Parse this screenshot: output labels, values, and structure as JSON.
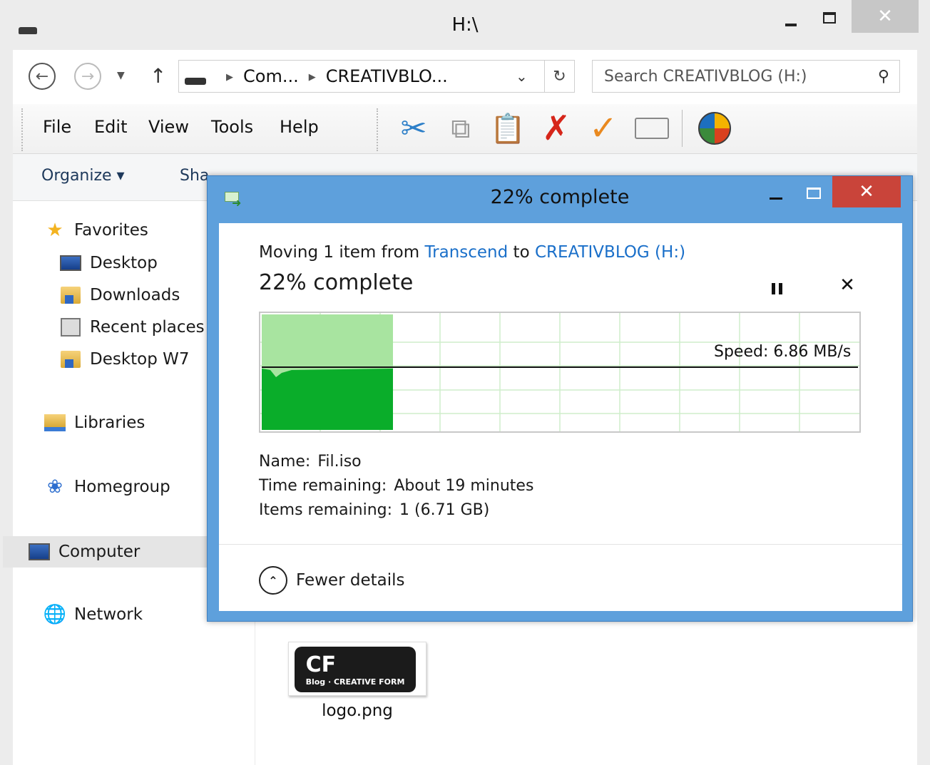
{
  "explorer": {
    "title": "H:\\",
    "close_glyph": "✕",
    "address": {
      "segments": [
        "Com...",
        "CREATIVBLO..."
      ],
      "search_placeholder": "Search CREATIVBLOG (H:)"
    },
    "menus": [
      "File",
      "Edit",
      "View",
      "Tools",
      "Help"
    ],
    "toolbar_icons": [
      "cut-icon",
      "copy-icon",
      "paste-icon",
      "delete-icon",
      "check-icon",
      "properties-icon",
      "windows-logo-icon"
    ],
    "commands": [
      "Organize ▾",
      "Sha"
    ],
    "nav": {
      "favorites": "Favorites",
      "desktop": "Desktop",
      "downloads": "Downloads",
      "recent": "Recent places",
      "desktop_w7": "Desktop W7",
      "libraries": "Libraries",
      "homegroup": "Homegroup",
      "computer": "Computer",
      "network": "Network"
    },
    "files": [
      {
        "label": "logo.png",
        "logo_text": "CF",
        "logo_sub": "Blog · CREATIVE FORM"
      }
    ]
  },
  "dialog": {
    "title": "22% complete",
    "close_glyph": "✕",
    "moving_prefix": "Moving 1 item from ",
    "source": "Transcend",
    "to_word": " to ",
    "destination": "CREATIVBLOG (H:)",
    "progress_text": "22% complete",
    "progress_fraction": 0.22,
    "cancel_glyph": "✕",
    "speed_label": "Speed: 6.86 MB/s",
    "details": {
      "name_key": "Name:",
      "name_val": "Fil.iso",
      "time_key": "Time remaining:",
      "time_val": "About 19 minutes",
      "items_key": "Items remaining:",
      "items_val": "1 (6.71 GB)"
    },
    "fewer_details": "Fewer details",
    "colors": {
      "accent": "#5ea0dc",
      "link": "#1a6fc9",
      "graph_fill": "#0aad2a",
      "graph_progress": "#a8e4a0",
      "close_red": "#c9443a"
    }
  }
}
